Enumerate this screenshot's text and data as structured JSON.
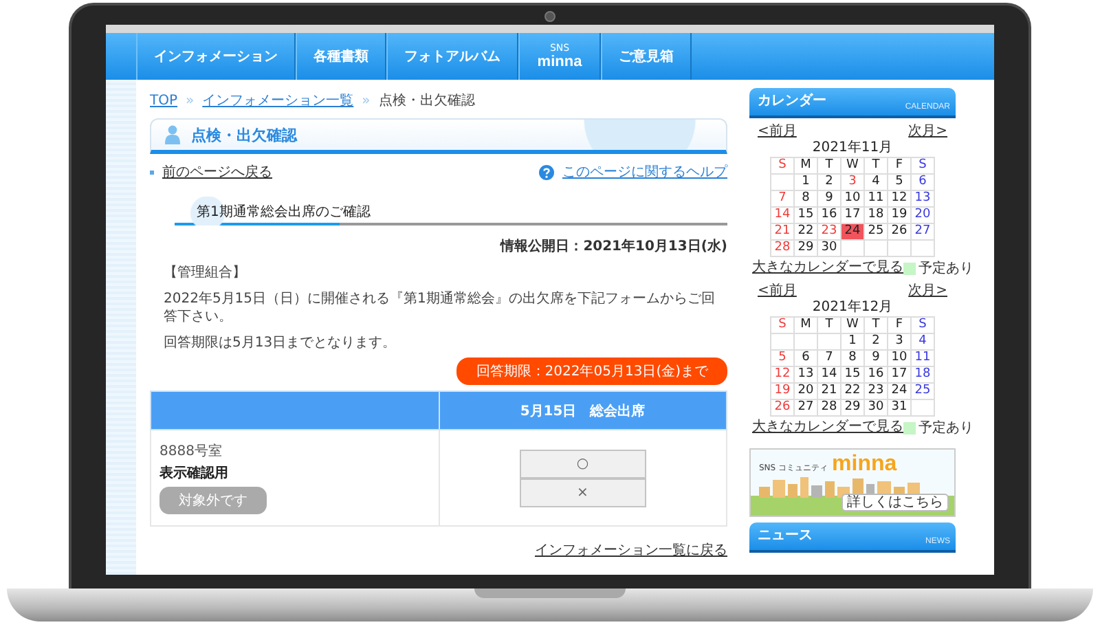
{
  "nav": {
    "items": [
      {
        "kind": "plain",
        "label": "インフォメーション"
      },
      {
        "kind": "plain",
        "label": "各種書類"
      },
      {
        "kind": "plain",
        "label": "フォトアルバム"
      },
      {
        "kind": "stacked",
        "small": "SNS",
        "label": "minna"
      },
      {
        "kind": "plain",
        "label": "ご意見箱"
      }
    ]
  },
  "breadcrumb": {
    "separator": "»",
    "items": [
      {
        "label": "TOP",
        "link": true
      },
      {
        "label": "インフォメーション一覧",
        "link": true
      },
      {
        "label": "点検・出欠確認",
        "link": false
      }
    ]
  },
  "page_title": "点検・出欠確認",
  "back_link": "前のページへ戻る",
  "help_link": "このページに関するヘルプ",
  "article": {
    "heading": "第1期通常総会出席のご確認",
    "published": "情報公開日：2021年10月13日(水)",
    "category": "【管理組合】",
    "paragraphs": [
      "2022年5月15日（日）に開催される『第1期通常総会』の出欠席を下記フォームからご回答下さい。",
      "回答期限は5月13日までとなります。"
    ],
    "deadline": "回答期限：2022年05月13日(金)まで"
  },
  "table": {
    "columns": [
      "5月15日　総会出席"
    ],
    "rows": [
      {
        "unit": "8888号室",
        "name": "表示確認用",
        "status_button": {
          "label": "対象外です",
          "disabled": true
        },
        "options": [
          {
            "label": "○",
            "selected": false
          },
          {
            "label": "×",
            "selected": false
          }
        ]
      }
    ]
  },
  "return_link": "インフォメーション一覧に戻る",
  "sidebar": {
    "calendar": {
      "title": "カレンダー",
      "subtitle": "CALENDAR",
      "months": [
        {
          "prev": "<前月",
          "next": "次月>",
          "title": "2021年11月",
          "large_link": "大きなカレンダーで見る",
          "legend": "予定あり",
          "weekdays": [
            {
              "label": "S",
              "kind": "sunday"
            },
            {
              "label": "M",
              "kind": "weekday"
            },
            {
              "label": "T",
              "kind": "weekday"
            },
            {
              "label": "W",
              "kind": "weekday"
            },
            {
              "label": "T",
              "kind": "weekday"
            },
            {
              "label": "F",
              "kind": "weekday"
            },
            {
              "label": "S",
              "kind": "saturday"
            }
          ],
          "weeks": [
            [
              {
                "kind": "blank"
              },
              {
                "day": "1",
                "kind": "weekday",
                "today": false
              },
              {
                "day": "2",
                "kind": "weekday",
                "today": false
              },
              {
                "day": "3",
                "kind": "holiday",
                "today": false
              },
              {
                "day": "4",
                "kind": "weekday",
                "today": false
              },
              {
                "day": "5",
                "kind": "weekday",
                "today": false
              },
              {
                "day": "6",
                "kind": "saturday",
                "today": false
              }
            ],
            [
              {
                "day": "7",
                "kind": "sunday",
                "today": false
              },
              {
                "day": "8",
                "kind": "weekday",
                "today": false
              },
              {
                "day": "9",
                "kind": "weekday",
                "today": false
              },
              {
                "day": "10",
                "kind": "weekday",
                "today": false
              },
              {
                "day": "11",
                "kind": "weekday",
                "today": false
              },
              {
                "day": "12",
                "kind": "weekday",
                "today": false
              },
              {
                "day": "13",
                "kind": "saturday",
                "today": false
              }
            ],
            [
              {
                "day": "14",
                "kind": "sunday",
                "today": false
              },
              {
                "day": "15",
                "kind": "weekday",
                "today": false
              },
              {
                "day": "16",
                "kind": "weekday",
                "today": false
              },
              {
                "day": "17",
                "kind": "weekday",
                "today": false
              },
              {
                "day": "18",
                "kind": "weekday",
                "today": false
              },
              {
                "day": "19",
                "kind": "weekday",
                "today": false
              },
              {
                "day": "20",
                "kind": "saturday",
                "today": false
              }
            ],
            [
              {
                "day": "21",
                "kind": "sunday",
                "today": false
              },
              {
                "day": "22",
                "kind": "weekday",
                "today": false
              },
              {
                "day": "23",
                "kind": "holiday",
                "today": false
              },
              {
                "day": "24",
                "kind": "weekday",
                "today": true
              },
              {
                "day": "25",
                "kind": "weekday",
                "today": false
              },
              {
                "day": "26",
                "kind": "weekday",
                "today": false
              },
              {
                "day": "27",
                "kind": "saturday",
                "today": false
              }
            ],
            [
              {
                "day": "28",
                "kind": "sunday",
                "today": false
              },
              {
                "day": "29",
                "kind": "weekday",
                "today": false
              },
              {
                "day": "30",
                "kind": "weekday",
                "today": false
              },
              {
                "kind": "blank"
              },
              {
                "kind": "blank"
              },
              {
                "kind": "blank"
              },
              {
                "kind": "blank"
              }
            ]
          ]
        },
        {
          "prev": "<前月",
          "next": "次月>",
          "title": "2021年12月",
          "large_link": "大きなカレンダーで見る",
          "legend": "予定あり",
          "weekdays": [
            {
              "label": "S",
              "kind": "sunday"
            },
            {
              "label": "M",
              "kind": "weekday"
            },
            {
              "label": "T",
              "kind": "weekday"
            },
            {
              "label": "W",
              "kind": "weekday"
            },
            {
              "label": "T",
              "kind": "weekday"
            },
            {
              "label": "F",
              "kind": "weekday"
            },
            {
              "label": "S",
              "kind": "saturday"
            }
          ],
          "weeks": [
            [
              {
                "kind": "blank"
              },
              {
                "kind": "blank"
              },
              {
                "kind": "blank"
              },
              {
                "day": "1",
                "kind": "weekday",
                "today": false
              },
              {
                "day": "2",
                "kind": "weekday",
                "today": false
              },
              {
                "day": "3",
                "kind": "weekday",
                "today": false
              },
              {
                "day": "4",
                "kind": "saturday",
                "today": false
              }
            ],
            [
              {
                "day": "5",
                "kind": "sunday",
                "today": false
              },
              {
                "day": "6",
                "kind": "weekday",
                "today": false
              },
              {
                "day": "7",
                "kind": "weekday",
                "today": false
              },
              {
                "day": "8",
                "kind": "weekday",
                "today": false
              },
              {
                "day": "9",
                "kind": "weekday",
                "today": false
              },
              {
                "day": "10",
                "kind": "weekday",
                "today": false
              },
              {
                "day": "11",
                "kind": "saturday",
                "today": false
              }
            ],
            [
              {
                "day": "12",
                "kind": "sunday",
                "today": false
              },
              {
                "day": "13",
                "kind": "weekday",
                "today": false
              },
              {
                "day": "14",
                "kind": "weekday",
                "today": false
              },
              {
                "day": "15",
                "kind": "weekday",
                "today": false
              },
              {
                "day": "16",
                "kind": "weekday",
                "today": false
              },
              {
                "day": "17",
                "kind": "weekday",
                "today": false
              },
              {
                "day": "18",
                "kind": "saturday",
                "today": false
              }
            ],
            [
              {
                "day": "19",
                "kind": "sunday",
                "today": false
              },
              {
                "day": "20",
                "kind": "weekday",
                "today": false
              },
              {
                "day": "21",
                "kind": "weekday",
                "today": false
              },
              {
                "day": "22",
                "kind": "weekday",
                "today": false
              },
              {
                "day": "23",
                "kind": "weekday",
                "today": false
              },
              {
                "day": "24",
                "kind": "weekday",
                "today": false
              },
              {
                "day": "25",
                "kind": "saturday",
                "today": false
              }
            ],
            [
              {
                "day": "26",
                "kind": "sunday",
                "today": false
              },
              {
                "day": "27",
                "kind": "weekday",
                "today": false
              },
              {
                "day": "28",
                "kind": "weekday",
                "today": false
              },
              {
                "day": "29",
                "kind": "weekday",
                "today": false
              },
              {
                "day": "30",
                "kind": "weekday",
                "today": false
              },
              {
                "day": "31",
                "kind": "weekday",
                "today": false
              },
              {
                "kind": "blank"
              }
            ]
          ]
        }
      ]
    },
    "banner": {
      "caption": "SNS コミュニティ",
      "logo": "minna",
      "button": "詳しくはこちら"
    },
    "news": {
      "title": "ニュース",
      "subtitle": "NEWS"
    }
  }
}
